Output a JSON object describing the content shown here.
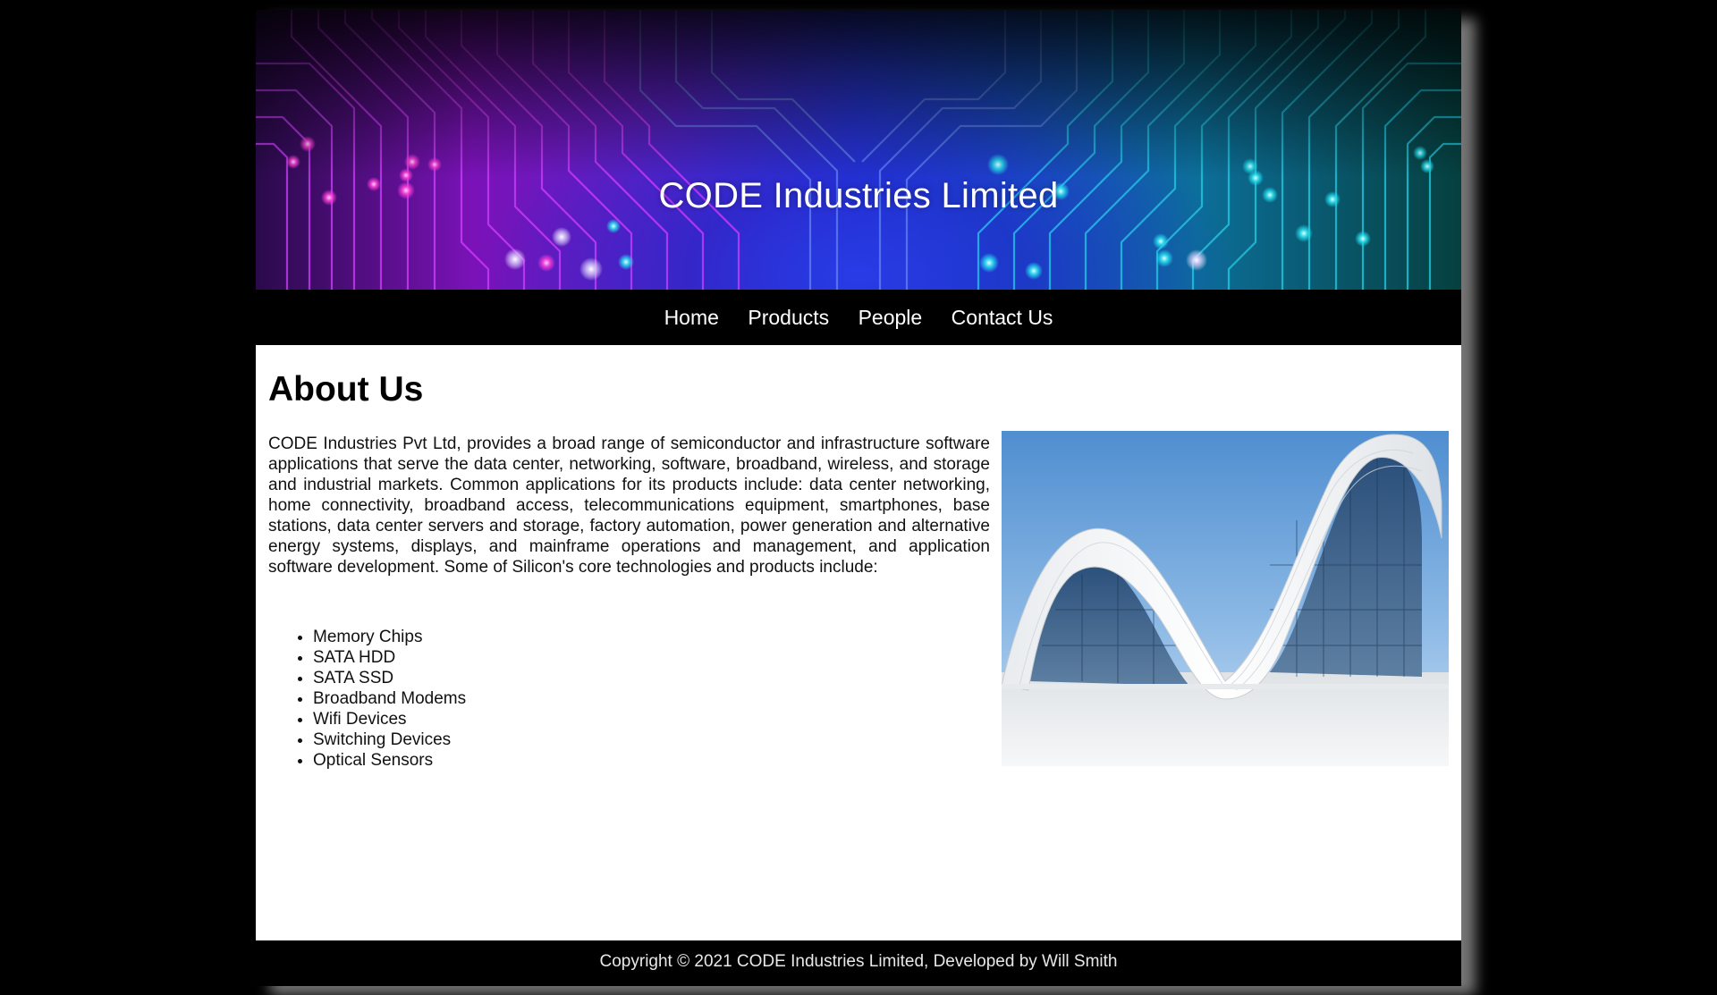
{
  "header": {
    "site_title": "CODE Industries Limited"
  },
  "nav": {
    "items": [
      "Home",
      "Products",
      "People",
      "Contact Us"
    ]
  },
  "main": {
    "heading": "About Us",
    "intro": "CODE Industries Pvt Ltd, provides a broad range of semiconductor and infrastructure software applications that serve the data center, networking, software, broadband, wireless, and storage and industrial markets. Common applications for its products include: data center networking, home connectivity, broadband access, telecommunications equipment, smartphones, base stations, data center servers and storage, factory automation, power generation and alternative energy systems, displays, and mainframe operations and management, and application software development. Some of Silicon's core technologies and products include:",
    "features": [
      "Memory Chips",
      "SATA HDD",
      "SATA SSD",
      "Broadband Modems",
      "Wifi Devices",
      "Switching Devices",
      "Optical Sensors"
    ]
  },
  "footer": {
    "text": "Copyright © 2021 CODE Industries Limited, Developed by Will Smith"
  },
  "colors": {
    "page_background": "#000000",
    "content_background": "#ffffff",
    "nav_text": "#ffffff",
    "banner_purple": "#7a12b8",
    "banner_blue": "#2a3ae0",
    "banner_teal": "#0c6f9a"
  }
}
